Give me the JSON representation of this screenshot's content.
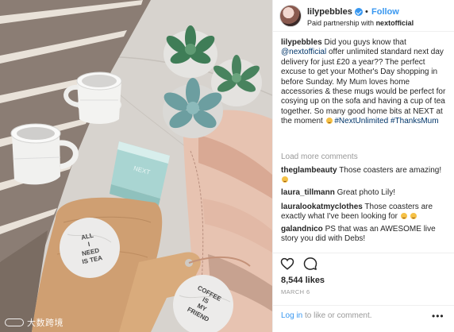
{
  "post": {
    "username": "lilypebbles",
    "follow_label": "Follow",
    "dot": "•",
    "partnership_prefix": "Paid partnership with",
    "partner": "nextofficial",
    "caption": {
      "user": "lilypebbles",
      "text_1": "Did you guys know that",
      "mention": "@nextofficial",
      "text_2": "offer unlimited standard next day delivery for just £20 a year?? The perfect excuse to get your Mother's Day shopping in before Sunday. My Mum loves home accessories & these mugs would be perfect for cosying up on the sofa and having a cup of tea together. So many good home bits at NEXT at the moment",
      "hashtag_1": "#NextUnlimited",
      "hashtag_2": "#ThanksMum"
    },
    "load_more": "Load more comments",
    "comments": [
      {
        "user": "theglambeauty",
        "text": "Those coasters are amazing!"
      },
      {
        "user": "laura_tillmann",
        "text": "Great photo Lily!"
      },
      {
        "user": "lauralookatmyclothes",
        "text": "Those coasters are exactly what I've been looking for"
      },
      {
        "user": "galandnico",
        "text": "PS that was an AWESOME live story you did with Debs!"
      }
    ],
    "likes": "8,544 likes",
    "date": "MARCH 6",
    "login_link": "Log in",
    "login_rest": "to like or comment.",
    "more": "•••"
  },
  "photo": {
    "coaster_1_text": [
      "ALL",
      "I",
      "NEED",
      "IS TEA"
    ],
    "coaster_2_text": [
      "COFFEE",
      "IS",
      "MY",
      "FRIEND"
    ],
    "candle_text": "NEXT"
  },
  "watermark": {
    "text": "大数跨境"
  },
  "icons": {
    "like": "heart-outline-icon",
    "comment": "speech-bubble-icon",
    "verified": "verified-badge-icon",
    "more": "more-options-icon"
  },
  "colors": {
    "link": "#3897f0",
    "mention": "#003569",
    "muted": "#999999",
    "text": "#262626"
  }
}
